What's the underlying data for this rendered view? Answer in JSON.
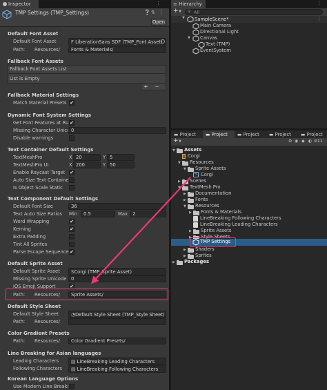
{
  "inspector": {
    "tab_label": "Inspector",
    "object_title": "TMP Settings (TMP_Settings)",
    "open_button": "Open",
    "sections": {
      "default_font_asset": {
        "header": "Default Font Asset",
        "label_font_asset": "Default Font Asset",
        "font_asset_value": "LiberationSans SDF (TMP_Font Asset)",
        "label_path": "Path:",
        "path_prefix": "Resources/",
        "path_value": "Fonts & Materials/"
      },
      "fallback_font_assets": {
        "header": "Fallback Font Assets",
        "list_title": "Fallback Font Assets List",
        "list_empty": "List is Empty",
        "add_label": "+",
        "remove_label": "−"
      },
      "fallback_material": {
        "header": "Fallback Material Settings",
        "label_match": "Match Material Presets",
        "check": "✔"
      },
      "dynamic_font": {
        "header": "Dynamic Font System Settings",
        "label_get_features": "Get Font Features at Runti",
        "check_get_features": "✔",
        "label_missing_unicode": "Missing Character Unicod",
        "missing_unicode_value": "0",
        "label_disable_warnings": "Disable warnings"
      },
      "text_container": {
        "header": "Text Container Default Settings",
        "label_textmeshpro": "TextMeshPro",
        "tmp_x_label": "X",
        "tmp_x": "20",
        "tmp_y_label": "Y",
        "tmp_y": "5",
        "label_textmeshpro_ui": "TextMeshPro UI",
        "ui_x_label": "X",
        "ui_x": "200",
        "ui_y_label": "Y",
        "ui_y": "50",
        "label_raycast": "Enable Raycast Target",
        "check_raycast": "✔",
        "label_auto_size": "Auto Size Text Container",
        "label_object_scale": "Is Object Scale Static"
      },
      "text_component": {
        "header": "Text Component Default Settings",
        "label_font_size": "Default Font Size",
        "font_size_value": "36",
        "label_auto_size_ratios": "Text Auto Size Ratios",
        "min_label": "Min",
        "min_value": "0.5",
        "max_label": "Max",
        "max_value": "2",
        "label_word_wrapping": "Word Wrapping",
        "check_word_wrapping": "✔",
        "label_kerning": "Kerning",
        "check_kerning": "✔",
        "label_extra_padding": "Extra Padding",
        "label_tint_sprites": "Tint All Sprites",
        "label_parse_escape": "Parse Escape Sequence",
        "check_parse_escape": "✔"
      },
      "default_sprite_asset": {
        "header": "Default Sprite Asset",
        "label_sprite_asset": "Default Sprite Asset",
        "sprite_asset_value": "Corgi (TMP_Sprite Asset)",
        "label_missing_unicode": "Missing Sprite Unicode",
        "missing_unicode_value": "0",
        "label_ios_emoji": "iOS Emoji Support",
        "check_ios_emoji": "✔",
        "label_path": "Path:",
        "path_prefix": "Resources/",
        "path_value": "Sprite Assets/"
      },
      "default_style_sheet": {
        "header": "Default Style Sheet",
        "label_style_sheet": "Default Style Sheet",
        "style_sheet_value": "Default Style Sheet (TMP_Style Sheet)",
        "label_path": "Path:",
        "path_prefix": "Resources/",
        "path_value": ""
      },
      "color_gradient": {
        "header": "Color Gradient Presets",
        "label_path": "Path:",
        "path_prefix": "Resources/",
        "path_value": "Color Gradient Presets/"
      },
      "line_breaking": {
        "header": "Line Breaking for Asian languages",
        "label_leading": "Leading Characters",
        "leading_value": "LineBreaking Leading Characters",
        "label_following": "Following Characters",
        "following_value": "LineBreaking Following Characters"
      },
      "korean": {
        "header": "Korean Language Options",
        "label_modern": "Use Modern Line Breaking"
      }
    }
  },
  "hierarchy": {
    "tab_label": "Hierarchy",
    "add_label": "+",
    "search_placeholder": "All",
    "items": {
      "scene": "SampleScene*",
      "main_camera": "Main Camera",
      "directional_light": "Directional Light",
      "canvas": "Canvas",
      "text_tmp": "Text (TMP)",
      "event_system": "EventSystem"
    }
  },
  "project": {
    "tabs": [
      "Project",
      "Project",
      "Project",
      "Project",
      "Project"
    ],
    "add_label": "+",
    "badge_count": "11",
    "items": {
      "assets": "Assets",
      "corgi_root": "Corgi",
      "resources": "Resources",
      "sprite_assets": "Sprite Assets",
      "corgi_sprite": "Corgi",
      "scenes": "Scenes",
      "textmesh_pro": "TextMesh Pro",
      "documentation": "Documentation",
      "fonts": "Fonts",
      "tmp_resources": "Resources",
      "fonts_materials": "Fonts & Materials",
      "lb_following": "LineBreaking Following Characters",
      "lb_leading": "LineBreaking Leading Characters",
      "tmp_sprite_assets": "Sprite Assets",
      "style_sheets": "Style Sheets",
      "tmp_settings": "TMP Settings",
      "shaders": "Shaders",
      "sprites": "Sprites",
      "packages": "Packages"
    }
  },
  "colors": {
    "highlight": "#f0367a",
    "selection": "#2c5d87",
    "panel": "#383838"
  }
}
